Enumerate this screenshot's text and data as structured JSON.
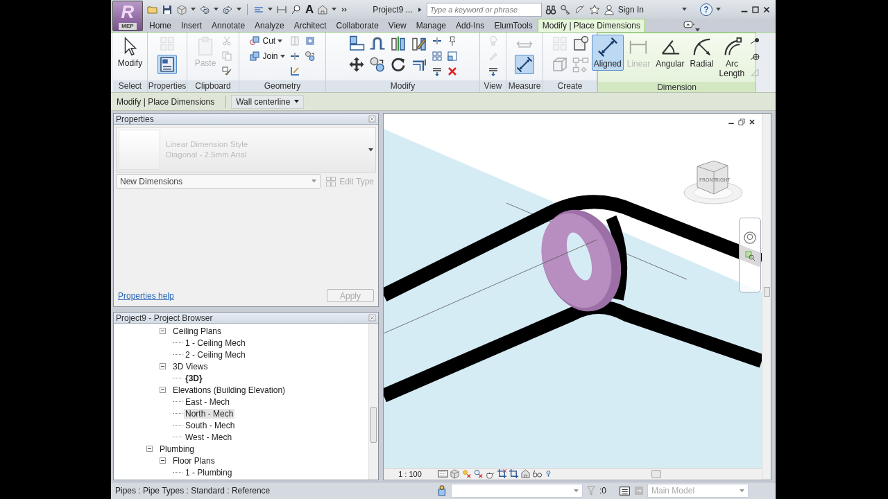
{
  "app_menu": {
    "logo": "R",
    "label": "MEP"
  },
  "quick_access": {
    "text_glyph": "A"
  },
  "title": "Project9 ...",
  "search": {
    "placeholder": "Type a keyword or phrase"
  },
  "sign_in": "Sign In",
  "help": "?",
  "tabs": [
    {
      "label": "Home",
      "selected": false
    },
    {
      "label": "Insert",
      "selected": false
    },
    {
      "label": "Annotate",
      "selected": false
    },
    {
      "label": "Analyze",
      "selected": false
    },
    {
      "label": "Architect",
      "selected": false
    },
    {
      "label": "Collaborate",
      "selected": false
    },
    {
      "label": "View",
      "selected": false
    },
    {
      "label": "Manage",
      "selected": false
    },
    {
      "label": "Add-Ins",
      "selected": false
    },
    {
      "label": "ElumTools",
      "selected": false
    },
    {
      "label": "Modify | Place Dimensions",
      "selected": true,
      "contextual": true
    }
  ],
  "ribbon": [
    {
      "title": "Select",
      "tools": [
        {
          "label": "Modify",
          "selected": false,
          "disabled": false
        }
      ]
    },
    {
      "title": "Properties",
      "icons": [
        {
          "disabled": true,
          "selected": false
        },
        {
          "disabled": false,
          "selected": true
        }
      ]
    },
    {
      "title": "Clipboard",
      "tools": [
        {
          "label": "Paste",
          "selected": false,
          "disabled": true
        }
      ],
      "icons": [
        {
          "disabled": true
        },
        {
          "disabled": true
        },
        {
          "disabled": false
        }
      ]
    },
    {
      "title": "Geometry",
      "tools": [
        {
          "label": "Cut",
          "selected": false,
          "disabled": false
        },
        {
          "label": "Join",
          "selected": false,
          "disabled": false
        }
      ],
      "icons": [
        {
          "disabled": true
        },
        {
          "disabled": false
        },
        {
          "disabled": false
        },
        {
          "disabled": false
        },
        {
          "disabled": false
        }
      ]
    },
    {
      "title": "Modify",
      "icons": [
        {
          "disabled": false
        },
        {
          "disabled": false
        },
        {
          "disabled": false
        },
        {
          "disabled": false
        },
        {
          "disabled": false
        },
        {
          "disabled": false
        },
        {
          "disabled": false
        },
        {
          "disabled": false
        },
        {
          "disabled": false
        },
        {
          "disabled": false
        },
        {
          "disabled": false
        },
        {
          "disabled": false
        },
        {
          "disabled": false
        },
        {
          "disabled": false
        }
      ]
    },
    {
      "title": "View",
      "icons": [
        {
          "disabled": true
        },
        {
          "disabled": true
        },
        {
          "disabled": false
        }
      ]
    },
    {
      "title": "Measure",
      "icons": [
        {
          "disabled": true,
          "selected": false
        },
        {
          "disabled": false,
          "selected": true
        }
      ]
    },
    {
      "title": "Create",
      "icons": [
        {
          "disabled": true
        },
        {
          "disabled": true
        },
        {
          "disabled": false
        },
        {
          "disabled": true
        }
      ]
    },
    {
      "title": "Dimension",
      "contextual": true,
      "tools": [
        {
          "label": "Aligned",
          "selected": true,
          "disabled": false
        },
        {
          "label": "Linear",
          "selected": false,
          "disabled": true
        },
        {
          "label": "Angular",
          "selected": false,
          "disabled": false
        },
        {
          "label": "Radial",
          "selected": false,
          "disabled": false
        },
        {
          "label": "Arc Length",
          "selected": false,
          "disabled": false
        }
      ],
      "icons": [
        {
          "disabled": false
        },
        {
          "disabled": false
        },
        {
          "disabled": true
        }
      ]
    }
  ],
  "options_bar": {
    "context": "Modify | Place Dimensions",
    "placement": "Wall centerline"
  },
  "properties": {
    "title": "Properties",
    "type_selector": {
      "family": "Linear Dimension Style",
      "type": "Diagonal - 2.5mm Arial",
      "disabled": true
    },
    "instance_filter": "New Dimensions",
    "edit_type": {
      "label": "Edit Type",
      "disabled": true
    },
    "help_link": "Properties help",
    "apply": {
      "label": "Apply",
      "disabled": true
    }
  },
  "project_browser": {
    "title": "Project9 - Project Browser",
    "tree": [
      {
        "children": [
          {
            "label": "Ceiling Plans",
            "expanded": true,
            "selected": false,
            "children": [
              {
                "label": "1 - Ceiling Mech",
                "selected": false,
                "current": false
              },
              {
                "label": "2 - Ceiling Mech",
                "selected": false,
                "current": false
              }
            ]
          },
          {
            "label": "3D Views",
            "expanded": true,
            "selected": false,
            "children": [
              {
                "label": "{3D}",
                "selected": false,
                "current": true
              }
            ]
          },
          {
            "label": "Elevations (Building Elevation)",
            "expanded": true,
            "selected": false,
            "children": [
              {
                "label": "East - Mech",
                "selected": false,
                "current": false
              },
              {
                "label": "North - Mech",
                "selected": true,
                "current": false
              },
              {
                "label": "South - Mech",
                "selected": false,
                "current": false
              },
              {
                "label": "West - Mech",
                "selected": false,
                "current": false
              }
            ]
          }
        ]
      },
      {
        "label": "Plumbing",
        "expanded": true,
        "selected": false,
        "children": [
          {
            "label": "Floor Plans",
            "expanded": true,
            "selected": false,
            "children": [
              {
                "label": "1 - Plumbing",
                "selected": false,
                "current": false
              }
            ]
          }
        ]
      }
    ]
  },
  "view": {
    "cube": {
      "front": "FRONT",
      "right": "RIGHT"
    },
    "scale": "1 : 100"
  },
  "status_bar": {
    "text": "Pipes : Pipe Types : Standard : Reference",
    "selection_count": ":0",
    "model": {
      "value": "Main Model",
      "disabled": true
    }
  }
}
